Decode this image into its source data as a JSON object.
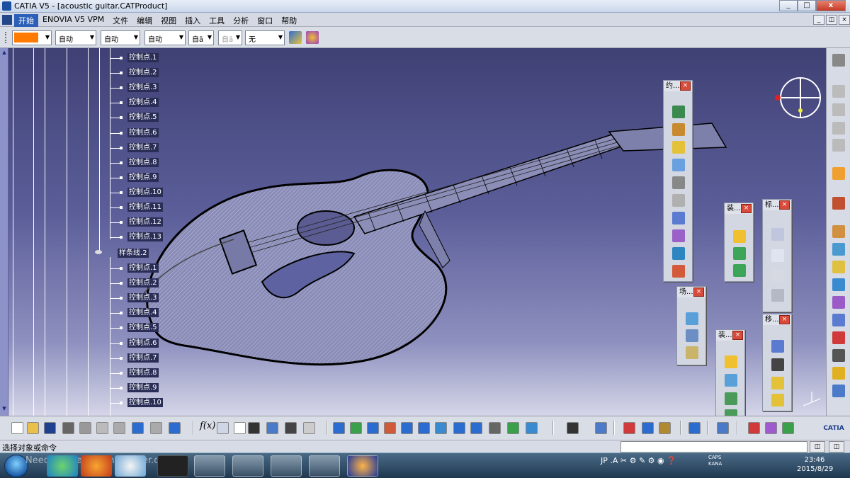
{
  "window": {
    "title": "CATIA V5 - [acoustic guitar.CATProduct]",
    "min": "_",
    "max": "□",
    "close": "x"
  },
  "menu": {
    "items": [
      "开始",
      "ENOVIA V5 VPM",
      "文件",
      "编辑",
      "视图",
      "插入",
      "工具",
      "分析",
      "窗口",
      "帮助"
    ]
  },
  "properties": {
    "color": "#ff7a00",
    "combos": [
      {
        "value": "自动",
        "disabled": false
      },
      {
        "value": "自动",
        "disabled": false
      },
      {
        "value": "自动",
        "disabled": false
      },
      {
        "value": "自ā",
        "disabled": false
      },
      {
        "value": "自ā",
        "disabled": true
      },
      {
        "value": "无",
        "disabled": false
      }
    ]
  },
  "tree": {
    "points_a": [
      "控制点.1",
      "控制点.2",
      "控制点.3",
      "控制点.4",
      "控制点.5",
      "控制点.6",
      "控制点.7",
      "控制点.8",
      "控制点.9",
      "控制点.10",
      "控制点.11",
      "控制点.12",
      "控制点.13"
    ],
    "spline": "样条线.2",
    "points_b": [
      "控制点.1",
      "控制点.2",
      "控制点.3",
      "控制点.4",
      "控制点.5",
      "控制点.6",
      "控制点.7",
      "控制点.8",
      "控制点.9",
      "控制点.10"
    ]
  },
  "panels": {
    "constraints": "约...",
    "assembly1": "装...",
    "annotation": "标...",
    "scene": "场...",
    "assembly2": "装...",
    "move": "移..."
  },
  "status": {
    "prompt": "选择对象或命令"
  },
  "bottom": {
    "formula": "f(x)"
  },
  "taskbar": {
    "watermark": "Needfor T /ancssonwl.lofter.com",
    "tray": "JP .A ✂ ⚙ ✎ ⚙ ◉ ❓",
    "caps": "CAPS",
    "kana": "KANA",
    "time": "23:46",
    "date": "2015/8/29"
  },
  "icons": [
    "catia-logo-icon",
    "compass-icon",
    "gear-icon",
    "cursor-arrow-icon",
    "new-file-icon",
    "open-folder-icon",
    "save-icon",
    "print-icon",
    "cut-icon",
    "copy-icon",
    "paste-icon",
    "undo-icon",
    "redo-icon",
    "help-icon",
    "camera-icon",
    "ds-catia-logo-icon"
  ]
}
